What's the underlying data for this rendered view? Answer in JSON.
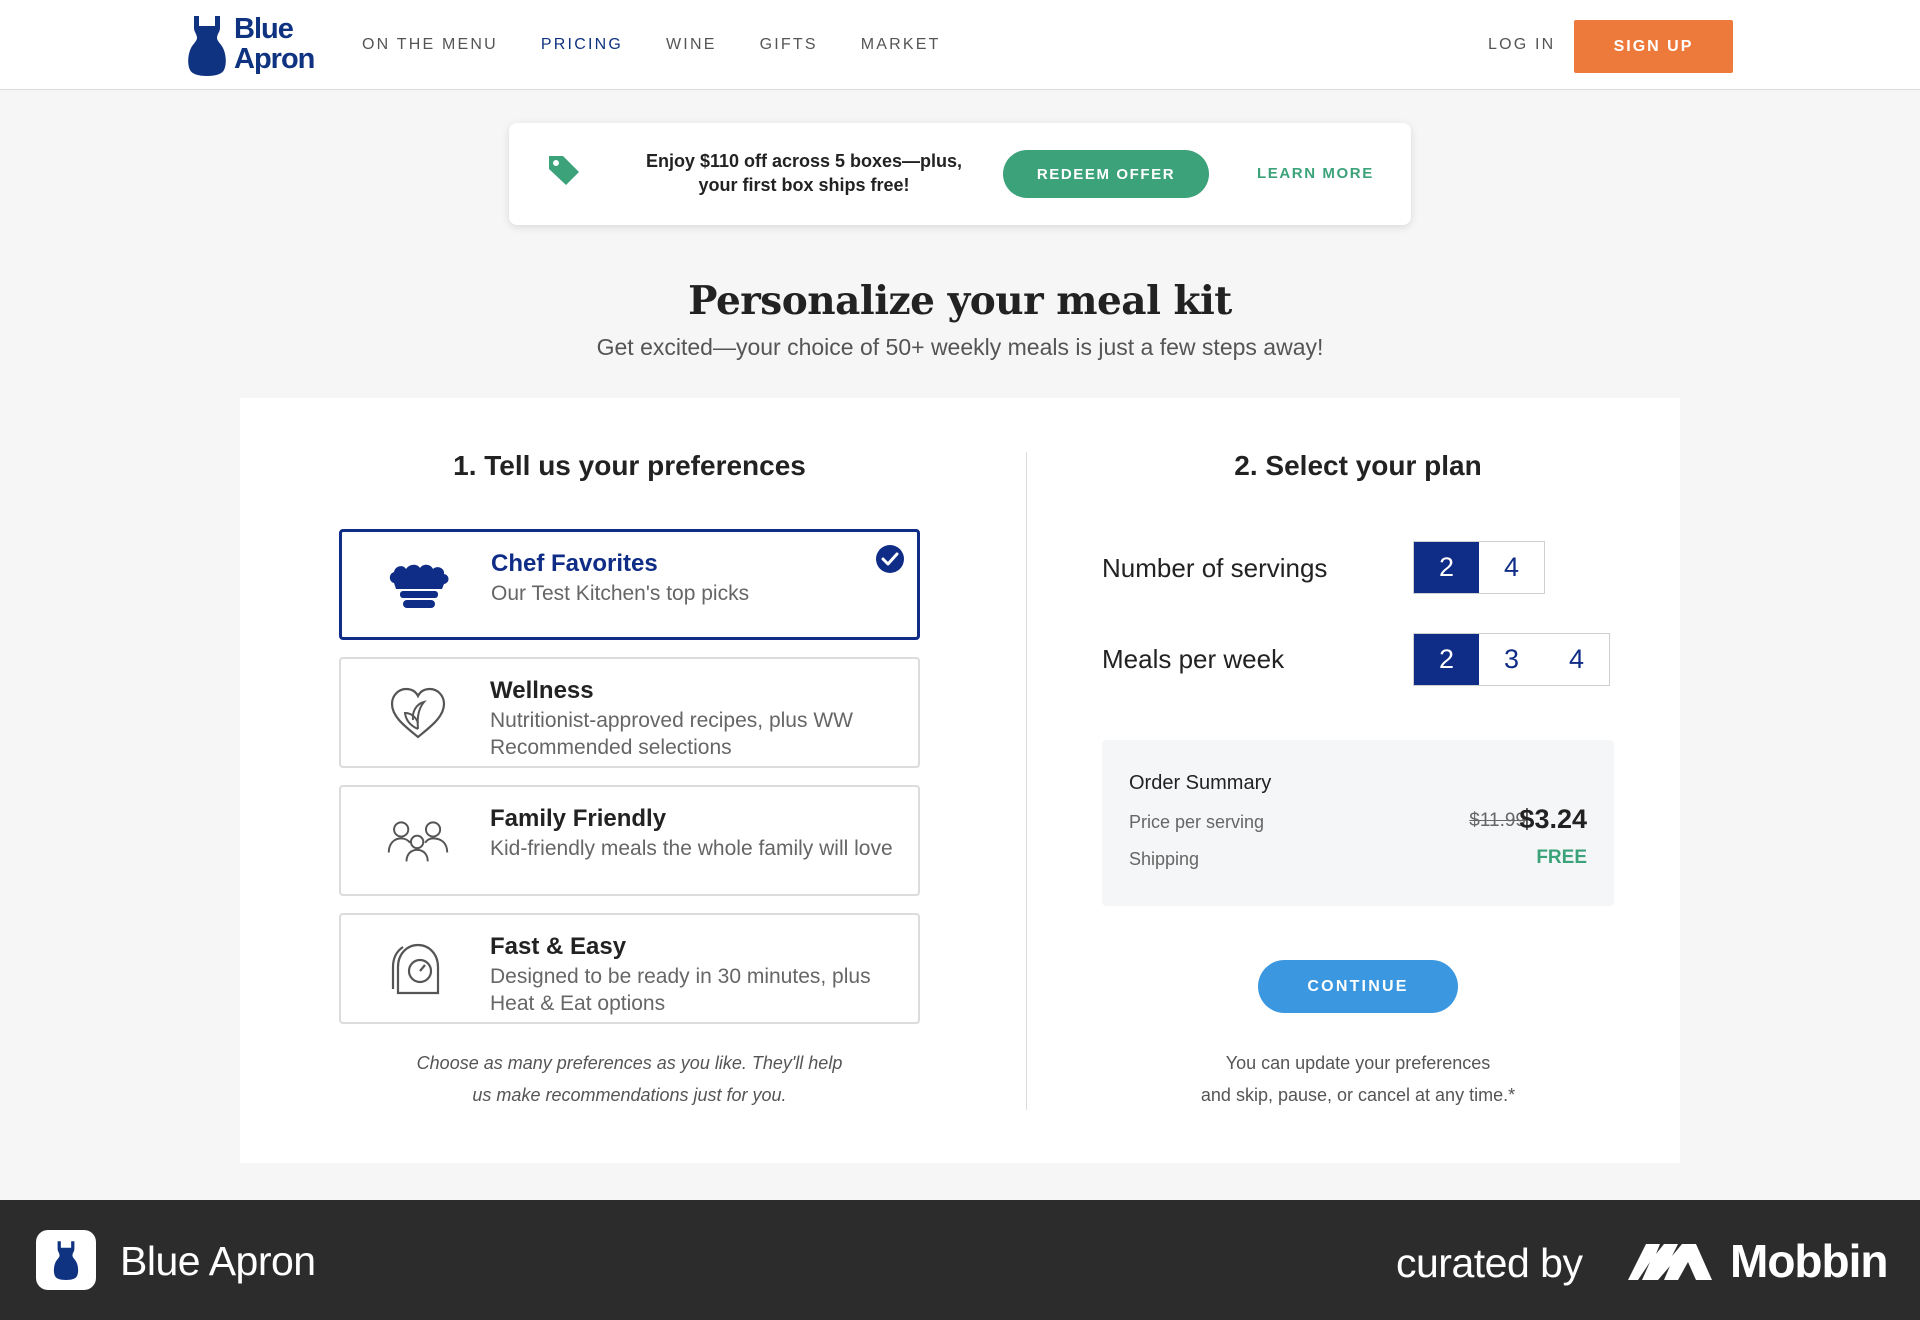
{
  "brand": {
    "logo_line1": "Blue",
    "logo_line2": "Apron",
    "color": "#0f3380"
  },
  "nav": {
    "items": [
      "ON THE MENU",
      "PRICING",
      "WINE",
      "GIFTS",
      "MARKET"
    ],
    "active": "PRICING",
    "login": "LOG IN",
    "signup": "SIGN UP"
  },
  "promo": {
    "icon": "tag-icon",
    "line1": "Enjoy $110 off across 5 boxes—plus,",
    "line2": "your first box ships free!",
    "redeem": "REDEEM OFFER",
    "learn_more": "LEARN MORE"
  },
  "page": {
    "title": "Personalize your meal kit",
    "subtitle": "Get excited—your choice of 50+ weekly meals is just a few steps away!"
  },
  "preferences": {
    "heading": "1. Tell us your preferences",
    "items": [
      {
        "title": "Chef Favorites",
        "desc": "Our Test Kitchen's top picks",
        "icon": "chef-hat-icon",
        "selected": true
      },
      {
        "title": "Wellness",
        "desc": "Nutritionist-approved recipes, plus WW Recommended selections",
        "icon": "heart-leaf-icon",
        "selected": false
      },
      {
        "title": "Family Friendly",
        "desc": "Kid-friendly meals the whole family will love",
        "icon": "family-icon",
        "selected": false
      },
      {
        "title": "Fast & Easy",
        "desc": "Designed to be ready in 30 minutes, plus Heat & Eat options",
        "icon": "timer-icon",
        "selected": false
      }
    ],
    "note_line1": "Choose as many preferences as you like. They'll help",
    "note_line2": "us make recommendations just for you."
  },
  "plan": {
    "heading": "2. Select your plan",
    "servings_label": "Number of servings",
    "servings_options": [
      "2",
      "4"
    ],
    "servings_selected": "2",
    "meals_label": "Meals per week",
    "meals_options": [
      "2",
      "3",
      "4"
    ],
    "meals_selected": "2",
    "summary": {
      "title": "Order Summary",
      "price_label": "Price per serving",
      "old_price": "$11.99",
      "new_price": "$3.24",
      "shipping_label": "Shipping",
      "shipping_value": "FREE"
    },
    "continue": "CONTINUE",
    "note_line1": "You can update your preferences",
    "note_line2": "and skip, pause, or cancel at any time.*"
  },
  "footer": {
    "app_name": "Blue Apron",
    "curated_by": "curated by",
    "mobbin": "Mobbin"
  },
  "colors": {
    "accent_blue": "#0f2c86",
    "green": "#3ca27a",
    "orange": "#ed7a3b",
    "continue_blue": "#3b98e0"
  }
}
